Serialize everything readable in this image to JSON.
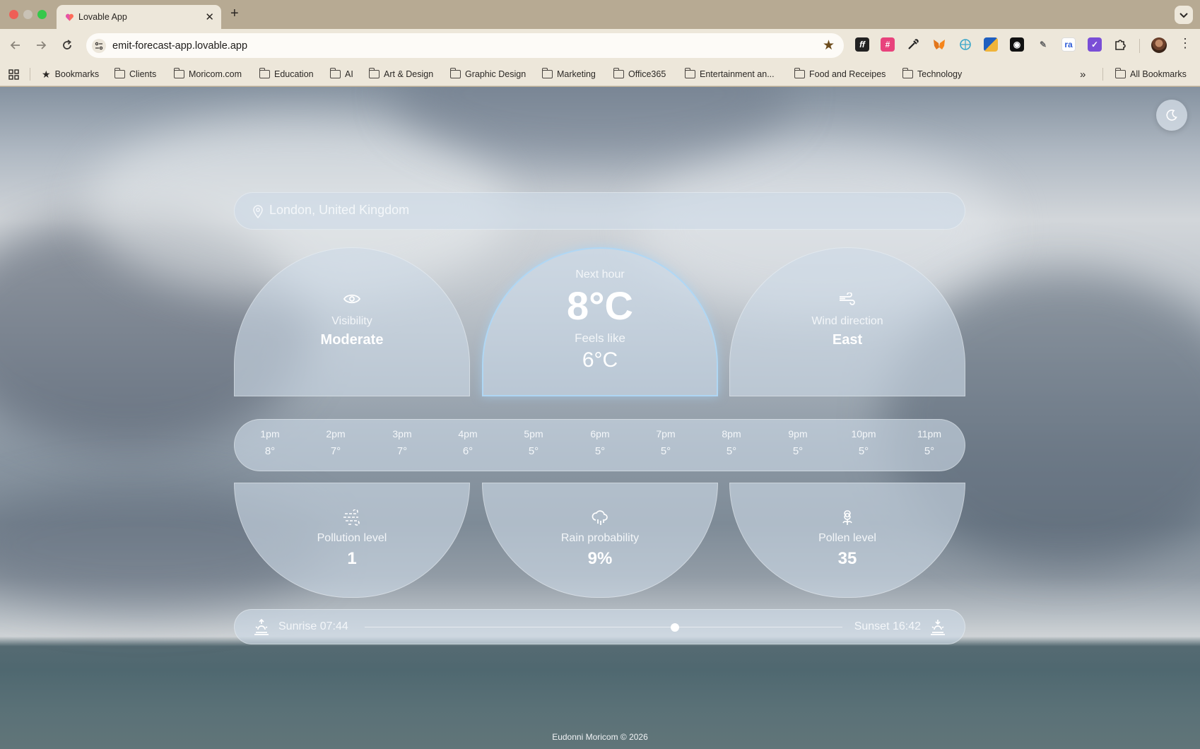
{
  "browser": {
    "tab_title": "Lovable App",
    "url": "emit-forecast-app.lovable.app",
    "extensions": [
      "ff-extension-icon",
      "grid-extension-icon",
      "eyedropper-icon",
      "metamask-icon",
      "globe-extension-icon",
      "photo-extension-icon",
      "ghost-extension-icon",
      "tool-extension-icon",
      "ra-extension-icon",
      "shield-extension-icon",
      "puzzle-icon"
    ],
    "ra_label": "ra",
    "ff_label": "ff"
  },
  "bookmarks": {
    "items": [
      {
        "label": "Bookmarks",
        "icon": "star-icon"
      },
      {
        "label": "Clients",
        "icon": "folder-icon"
      },
      {
        "label": "Moricom.com",
        "icon": "folder-icon"
      },
      {
        "label": "Education",
        "icon": "folder-icon"
      },
      {
        "label": "AI",
        "icon": "folder-icon"
      },
      {
        "label": "Art & Design",
        "icon": "folder-icon"
      },
      {
        "label": "Graphic Design",
        "icon": "folder-icon"
      },
      {
        "label": "Marketing",
        "icon": "folder-icon"
      },
      {
        "label": "Office365",
        "icon": "folder-icon"
      },
      {
        "label": "Entertainment an...",
        "icon": "folder-icon"
      },
      {
        "label": "Food and Receipes",
        "icon": "folder-icon"
      },
      {
        "label": "Technology",
        "icon": "folder-icon"
      }
    ],
    "overflow": "»",
    "all_bookmarks": "All Bookmarks"
  },
  "weather": {
    "location": "London, United Kingdom",
    "visibility": {
      "label": "Visibility",
      "value": "Moderate"
    },
    "current": {
      "caption": "Next hour",
      "temp": "8°C",
      "feels_label": "Feels like",
      "feels_value": "6°C"
    },
    "wind": {
      "label": "Wind direction",
      "value": "East"
    },
    "hourly": [
      {
        "time": "1pm",
        "temp": "8°"
      },
      {
        "time": "2pm",
        "temp": "7°"
      },
      {
        "time": "3pm",
        "temp": "7°"
      },
      {
        "time": "4pm",
        "temp": "6°"
      },
      {
        "time": "5pm",
        "temp": "5°"
      },
      {
        "time": "6pm",
        "temp": "5°"
      },
      {
        "time": "7pm",
        "temp": "5°"
      },
      {
        "time": "8pm",
        "temp": "5°"
      },
      {
        "time": "9pm",
        "temp": "5°"
      },
      {
        "time": "10pm",
        "temp": "5°"
      },
      {
        "time": "11pm",
        "temp": "5°"
      }
    ],
    "pollution": {
      "label": "Pollution level",
      "value": "1"
    },
    "rain": {
      "label": "Rain probability",
      "value": "9%"
    },
    "pollen": {
      "label": "Pollen level",
      "value": "35"
    },
    "sunrise": "Sunrise 07:44",
    "sunset": "Sunset 16:42",
    "day_progress": 0.65
  },
  "footer": "Eudonni Moricom © 2026"
}
